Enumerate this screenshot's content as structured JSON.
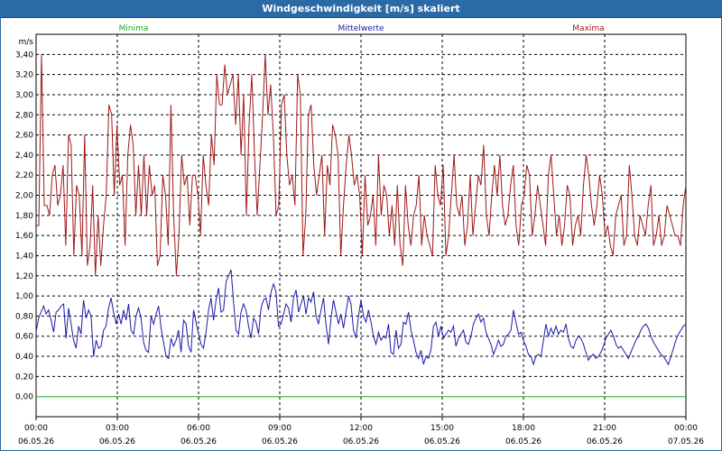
{
  "window": {
    "title": "Windgeschwindigkeit [m/s] skaliert"
  },
  "colors": {
    "min": "#1fa81f",
    "mean": "#1a1aa8",
    "max": "#a01818",
    "grid": "#000000"
  },
  "chart_data": {
    "type": "line",
    "title": "Windgeschwindigkeit [m/s] skaliert",
    "ylabel": "m/s",
    "ylim": [
      -0.2,
      3.6
    ],
    "yticks": [
      "0,00",
      "0,20",
      "0,40",
      "0,60",
      "0,80",
      "1,00",
      "1,20",
      "1,40",
      "1,60",
      "1,80",
      "2,00",
      "2,20",
      "2,40",
      "2,60",
      "2,80",
      "3,00",
      "3,20",
      "3,40"
    ],
    "xlim_hours": [
      0,
      24
    ],
    "xticks": [
      {
        "time": "00:00",
        "date": "06.05.26"
      },
      {
        "time": "03:00",
        "date": "06.05.26"
      },
      {
        "time": "06:00",
        "date": "06.05.26"
      },
      {
        "time": "09:00",
        "date": "06.05.26"
      },
      {
        "time": "12:00",
        "date": "06.05.26"
      },
      {
        "time": "15:00",
        "date": "06.05.26"
      },
      {
        "time": "18:00",
        "date": "06.05.26"
      },
      {
        "time": "21:00",
        "date": "06.05.26"
      },
      {
        "time": "00:00",
        "date": "07.05.26"
      }
    ],
    "legend": [
      "Minima",
      "Mittelwerte",
      "Maxima"
    ],
    "x_step_hours": 0.1,
    "series": [
      {
        "name": "Minima",
        "color": "#1fa81f",
        "values": [
          0.0,
          0.0,
          0.0,
          0.0,
          0.0,
          0.0,
          0.0,
          0.0,
          0.0,
          0.0,
          0.0,
          0.0,
          0.0,
          0.0,
          0.0,
          0.0,
          0.0,
          0.0,
          0.0,
          0.0,
          0.0,
          0.0,
          0.0,
          0.0,
          0.0,
          0.0,
          0.0,
          0.0,
          0.0,
          0.0,
          0.0,
          0.0,
          0.0,
          0.0,
          0.0,
          0.0,
          0.0,
          0.0,
          0.0,
          0.0,
          0.0,
          0.0,
          0.0,
          0.0,
          0.0,
          0.0,
          0.0,
          0.0,
          0.0,
          0.0,
          0.0,
          0.0,
          0.0,
          0.0,
          0.0,
          0.0,
          0.0,
          0.0,
          0.0,
          0.0,
          0.0,
          0.0,
          0.0,
          0.0,
          0.0,
          0.0,
          0.0,
          0.0,
          0.0,
          0.0,
          0.0,
          0.0,
          0.0,
          0.0,
          0.0,
          0.0,
          0.0,
          0.0,
          0.0,
          0.0,
          0.0,
          0.0,
          0.0,
          0.0,
          0.0,
          0.0,
          0.0,
          0.0,
          0.0,
          0.0,
          0.0,
          0.0,
          0.0,
          0.0,
          0.0,
          0.0,
          0.0,
          0.0,
          0.0,
          0.0,
          0.0,
          0.0,
          0.0,
          0.0,
          0.0,
          0.0,
          0.0,
          0.0,
          0.0,
          0.0,
          0.0,
          0.0,
          0.0,
          0.0,
          0.0,
          0.0,
          0.0,
          0.0,
          0.0,
          0.0,
          0.0,
          0.0,
          0.0,
          0.0,
          0.0,
          0.0,
          0.0,
          0.0,
          0.0,
          0.0,
          0.0,
          0.0,
          0.0,
          0.0,
          0.0,
          0.0,
          0.0,
          0.0,
          0.0,
          0.0,
          0.0,
          0.0,
          0.0,
          0.0,
          0.0,
          0.0,
          0.0,
          0.0,
          0.0,
          0.0,
          0.0,
          0.0,
          0.0,
          0.0,
          0.0,
          0.0,
          0.0,
          0.0,
          0.0,
          0.0,
          0.0,
          0.0,
          0.0,
          0.0,
          0.0,
          0.0,
          0.0,
          0.0,
          0.0,
          0.0,
          0.0,
          0.0,
          0.0,
          0.0,
          0.0,
          0.0,
          0.0,
          0.0,
          0.0,
          0.0,
          0.0,
          0.0,
          0.0,
          0.0,
          0.0,
          0.0,
          0.0,
          0.0,
          0.0,
          0.0,
          0.0,
          0.0,
          0.0,
          0.0,
          0.0,
          0.0,
          0.0,
          0.0,
          0.0,
          0.0,
          0.0,
          0.0,
          0.0,
          0.0,
          0.0,
          0.0,
          0.0,
          0.0,
          0.0,
          0.0,
          0.0,
          0.0,
          0.0,
          0.0,
          0.0,
          0.0,
          0.0,
          0.0,
          0.0,
          0.0,
          0.0,
          0.0,
          0.0,
          0.0,
          0.0,
          0.0,
          0.0,
          0.0,
          0.0,
          0.0,
          0.0,
          0.0,
          0.0,
          0.0,
          0.0
        ]
      },
      {
        "name": "Mittelwerte",
        "color": "#1a1aa8",
        "values": [
          0.65,
          0.78,
          0.84,
          0.9,
          0.82,
          0.86,
          0.76,
          0.64,
          0.84,
          0.86,
          0.9,
          0.92,
          0.58,
          0.88,
          0.72,
          0.56,
          0.48,
          0.7,
          0.62,
          0.96,
          0.78,
          0.86,
          0.8,
          0.4,
          0.56,
          0.48,
          0.5,
          0.66,
          0.7,
          0.88,
          0.98,
          0.84,
          0.72,
          0.82,
          0.72,
          0.86,
          0.76,
          0.92,
          0.66,
          0.62,
          0.8,
          0.88,
          0.78,
          0.54,
          0.46,
          0.44,
          0.8,
          0.72,
          0.82,
          0.9,
          0.68,
          0.54,
          0.4,
          0.38,
          0.58,
          0.5,
          0.56,
          0.66,
          0.44,
          0.76,
          0.72,
          0.5,
          0.44,
          0.86,
          0.74,
          0.62,
          0.52,
          0.48,
          0.64,
          0.86,
          0.98,
          0.76,
          0.96,
          1.08,
          0.84,
          0.86,
          1.14,
          1.2,
          1.26,
          0.94,
          0.66,
          0.62,
          0.84,
          0.92,
          0.86,
          0.7,
          0.58,
          0.78,
          0.74,
          0.62,
          0.88,
          0.96,
          0.98,
          0.86,
          1.04,
          1.12,
          1.04,
          0.7,
          0.72,
          0.82,
          0.92,
          0.88,
          0.74,
          0.98,
          1.06,
          0.84,
          0.92,
          1.0,
          0.82,
          0.98,
          0.94,
          1.04,
          0.8,
          0.72,
          0.86,
          0.98,
          0.72,
          0.52,
          0.78,
          0.96,
          0.84,
          0.72,
          0.82,
          0.68,
          0.84,
          1.0,
          0.92,
          0.66,
          0.58,
          0.8,
          0.96,
          0.8,
          0.74,
          0.86,
          0.74,
          0.6,
          0.52,
          0.64,
          0.56,
          0.6,
          0.58,
          0.72,
          0.44,
          0.42,
          0.66,
          0.48,
          0.52,
          0.74,
          0.72,
          0.84,
          0.66,
          0.56,
          0.44,
          0.38,
          0.46,
          0.32,
          0.4,
          0.38,
          0.46,
          0.7,
          0.74,
          0.6,
          0.7,
          0.58,
          0.62,
          0.66,
          0.64,
          0.7,
          0.5,
          0.58,
          0.62,
          0.66,
          0.54,
          0.52,
          0.6,
          0.72,
          0.78,
          0.82,
          0.74,
          0.78,
          0.64,
          0.58,
          0.52,
          0.42,
          0.48,
          0.56,
          0.5,
          0.52,
          0.6,
          0.62,
          0.66,
          0.86,
          0.74,
          0.62,
          0.64,
          0.56,
          0.5,
          0.42,
          0.4,
          0.32,
          0.4,
          0.42,
          0.4,
          0.56,
          0.72,
          0.6,
          0.68,
          0.62,
          0.7,
          0.62,
          0.66,
          0.64,
          0.72,
          0.58,
          0.5,
          0.48,
          0.56,
          0.6,
          0.58,
          0.52,
          0.44,
          0.36,
          0.4,
          0.42,
          0.38,
          0.4,
          0.44,
          0.5,
          0.58,
          0.62,
          0.66,
          0.6,
          0.52,
          0.48,
          0.5,
          0.46,
          0.42,
          0.38,
          0.44,
          0.5,
          0.56,
          0.6,
          0.66,
          0.7,
          0.72,
          0.68,
          0.6,
          0.54,
          0.5,
          0.46,
          0.42,
          0.4,
          0.36,
          0.32,
          0.4,
          0.48,
          0.56,
          0.62,
          0.66,
          0.7,
          0.72
        ]
      },
      {
        "name": "Maxima",
        "color": "#a01818",
        "values": [
          1.7,
          1.7,
          3.4,
          1.9,
          1.9,
          1.8,
          2.2,
          2.3,
          1.9,
          2.0,
          2.3,
          1.5,
          2.6,
          2.5,
          1.4,
          2.1,
          2.0,
          1.4,
          2.6,
          1.3,
          1.5,
          2.1,
          1.2,
          1.8,
          1.3,
          1.7,
          2.0,
          2.9,
          2.8,
          2.0,
          2.7,
          2.1,
          2.2,
          1.5,
          2.4,
          2.7,
          2.5,
          1.8,
          2.3,
          1.8,
          2.4,
          1.8,
          2.3,
          2.0,
          2.1,
          1.3,
          1.4,
          2.2,
          2.0,
          1.5,
          2.9,
          1.8,
          1.2,
          1.6,
          2.4,
          2.1,
          2.2,
          1.7,
          2.2,
          2.2,
          2.0,
          1.6,
          2.4,
          2.1,
          1.9,
          2.6,
          2.3,
          3.2,
          2.9,
          2.9,
          3.3,
          3.0,
          3.1,
          3.2,
          2.7,
          3.2,
          2.4,
          3.0,
          1.8,
          2.7,
          3.2,
          2.4,
          1.8,
          2.3,
          2.8,
          3.4,
          2.8,
          3.1,
          2.6,
          1.8,
          1.9,
          2.9,
          3.0,
          2.4,
          2.1,
          2.2,
          1.9,
          3.2,
          3.0,
          1.4,
          1.8,
          2.8,
          2.9,
          2.3,
          2.0,
          2.2,
          2.4,
          1.6,
          2.3,
          2.1,
          2.7,
          2.6,
          2.4,
          1.4,
          1.9,
          2.3,
          2.6,
          2.4,
          2.1,
          2.2,
          2.0,
          1.4,
          2.2,
          1.7,
          1.8,
          2.0,
          1.5,
          2.4,
          1.8,
          2.1,
          2.0,
          1.6,
          1.9,
          1.5,
          2.1,
          1.5,
          1.3,
          2.1,
          1.7,
          1.5,
          1.8,
          1.9,
          2.2,
          1.5,
          1.8,
          1.6,
          1.5,
          1.4,
          2.3,
          2.0,
          1.9,
          2.3,
          1.4,
          1.6,
          2.0,
          2.4,
          1.9,
          1.8,
          2.0,
          1.5,
          1.7,
          2.2,
          1.6,
          1.9,
          2.2,
          2.1,
          2.5,
          1.8,
          1.6,
          2.0,
          2.3,
          2.0,
          2.4,
          1.9,
          1.7,
          1.8,
          2.1,
          2.3,
          1.7,
          1.5,
          1.9,
          2.0,
          2.3,
          2.2,
          1.6,
          1.8,
          2.1,
          1.9,
          1.7,
          1.5,
          2.2,
          2.4,
          2.0,
          1.6,
          1.8,
          1.5,
          1.7,
          2.1,
          2.0,
          1.5,
          1.7,
          1.8,
          1.6,
          2.1,
          2.4,
          2.2,
          1.9,
          1.7,
          1.9,
          2.2,
          2.0,
          1.6,
          1.7,
          1.5,
          1.4,
          1.8,
          1.9,
          2.0,
          1.5,
          1.6,
          2.3,
          2.0,
          1.6,
          1.5,
          1.8,
          1.7,
          1.6,
          1.9,
          2.1,
          1.5,
          1.6,
          1.8,
          1.5,
          1.6,
          1.9,
          1.8,
          1.7,
          1.6,
          1.6,
          1.5,
          1.9,
          2.1
        ]
      }
    ]
  }
}
